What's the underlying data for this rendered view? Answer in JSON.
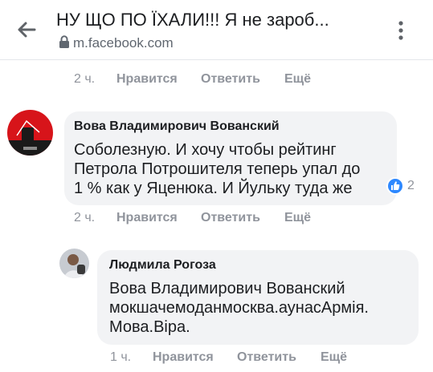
{
  "header": {
    "title": "НУ ЩО ПО ЇХАЛИ!!! Я не зароб...",
    "url": "m.facebook.com",
    "back_icon": "arrow-left-icon",
    "menu_icon": "more-vertical-icon"
  },
  "comments": [
    {
      "meta": {
        "time": "2 ч.",
        "like": "Нравится",
        "reply": "Ответить",
        "more": "Ещё"
      }
    },
    {
      "author": "Вова Владимирович Вованский",
      "text_lines": [
        "Соболезную. И хочу чтобы рейтинг",
        "Петрола Потрошителя теперь упал до",
        "1 % как у Яценюка. И Йульку туда же"
      ],
      "reaction_count": "2",
      "meta": {
        "time": "2 ч.",
        "like": "Нравится",
        "reply": "Ответить",
        "more": "Ещё"
      }
    },
    {
      "author": "Людмила Рогоза",
      "text_lines": [
        "Вова Владимирович Вованский",
        "мокшачемоданмосква.аунасАрмія.",
        "Мова.Віра."
      ],
      "meta": {
        "time": "1 ч.",
        "like": "Нравится",
        "reply": "Ответить",
        "more": "Ещё"
      }
    }
  ],
  "colors": {
    "bubble": "#f2f3f5",
    "meta": "#90949c",
    "like_badge": "#2d88ff"
  }
}
